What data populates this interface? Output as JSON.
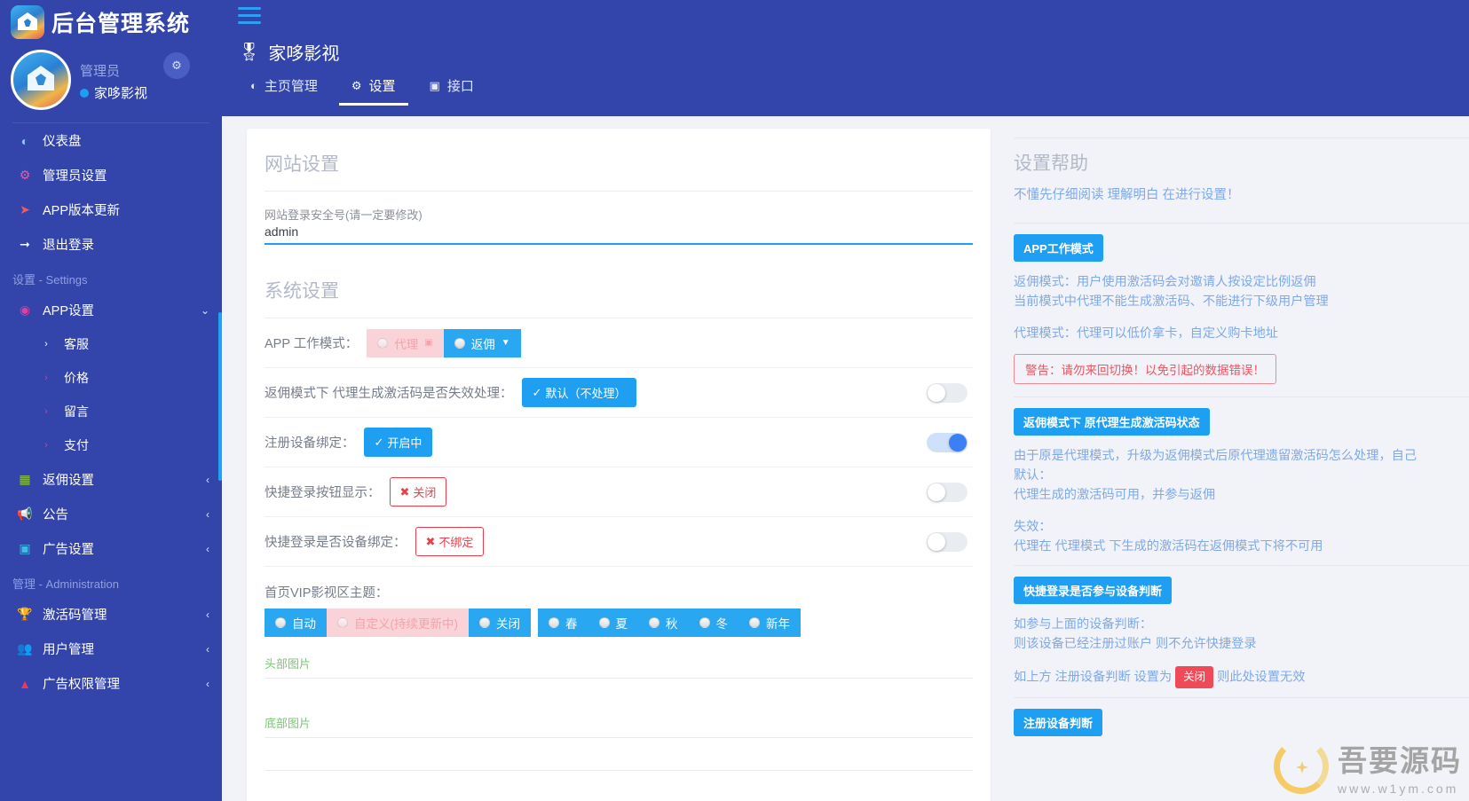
{
  "sidebar": {
    "brand_title": "后台管理系统",
    "gear_icon": "gear-icon",
    "profile": {
      "role": "管理员",
      "name": "家哆影视"
    },
    "top_items": [
      {
        "label": "仪表盘",
        "icon": "dashboard-icon"
      },
      {
        "label": "管理员设置",
        "icon": "gears-icon"
      },
      {
        "label": "APP版本更新",
        "icon": "paper-plane-icon"
      },
      {
        "label": "退出登录",
        "icon": "logout-icon"
      }
    ],
    "group_settings_title": "设置 - Settings",
    "settings_items": [
      {
        "label": "APP设置",
        "icon": "android-icon",
        "caret": "⌄",
        "expanded": true
      },
      {
        "label": "客服",
        "icon": "chevron-right-icon",
        "sub": true
      },
      {
        "label": "价格",
        "icon": "chevron-right-icon",
        "sub": true
      },
      {
        "label": "留言",
        "icon": "chevron-right-icon",
        "sub": true
      },
      {
        "label": "支付",
        "icon": "chevron-right-icon",
        "sub": true
      },
      {
        "label": "返佣设置",
        "icon": "card-icon",
        "caret": "‹"
      },
      {
        "label": "公告",
        "icon": "megaphone-icon",
        "caret": "‹"
      },
      {
        "label": "广告设置",
        "icon": "image-icon",
        "caret": "‹"
      }
    ],
    "group_admin_title": "管理 - Administration",
    "admin_items": [
      {
        "label": "激活码管理",
        "icon": "trophy-icon",
        "caret": "‹"
      },
      {
        "label": "用户管理",
        "icon": "users-icon",
        "caret": "‹"
      },
      {
        "label": "广告权限管理",
        "icon": "badge-icon",
        "caret": "‹"
      }
    ]
  },
  "topbar": {
    "hamburger": "hamburger-icon",
    "page_title": "家哆影视",
    "page_title_icon": "medal-icon",
    "tabs": [
      {
        "label": "主页管理",
        "icon": "home-manage-icon",
        "active": false
      },
      {
        "label": "设置",
        "icon": "gear-icon",
        "active": true
      },
      {
        "label": "接口",
        "icon": "api-icon",
        "active": false
      }
    ]
  },
  "form": {
    "section_site_title": "网站设置",
    "security_field_label": "网站登录安全号(请一定要修改)",
    "security_field_value": "admin",
    "section_system_title": "系统设置",
    "work_mode": {
      "label": "APP 工作模式：",
      "options": [
        {
          "label": "代理",
          "state": "disabled",
          "suffix_icon": "stamp-icon"
        },
        {
          "label": "返佣",
          "state": "active",
          "suffix_icon": "funnel-icon"
        }
      ]
    },
    "rows": [
      {
        "label": "返佣模式下 代理生成激活码是否失效处理：",
        "button": "默认（不处理）",
        "button_style": "blue",
        "button_icon": "check-circle-icon",
        "toggle": "off"
      },
      {
        "label": "注册设备绑定：",
        "button": "开启中",
        "button_style": "blue",
        "button_icon": "check-circle-icon",
        "toggle": "on"
      },
      {
        "label": "快捷登录按钮显示：",
        "button": "关闭",
        "button_style": "red-outline",
        "button_icon": "x-icon",
        "toggle": "off"
      },
      {
        "label": "快捷登录是否设备绑定：",
        "button": "不绑定",
        "button_style": "red-outline",
        "button_icon": "x-icon",
        "toggle": "off"
      }
    ],
    "theme": {
      "label": "首页VIP影视区主题：",
      "group_a": [
        {
          "label": "自动",
          "state": "active"
        },
        {
          "label": "自定义(持续更新中)",
          "state": "disabled"
        },
        {
          "label": "关闭",
          "state": "active"
        }
      ],
      "group_b": [
        {
          "label": "春",
          "state": "active"
        },
        {
          "label": "夏",
          "state": "active"
        },
        {
          "label": "秋",
          "state": "active"
        },
        {
          "label": "冬",
          "state": "active"
        },
        {
          "label": "新年",
          "state": "active"
        }
      ]
    },
    "header_image_label": "头部图片",
    "footer_image_label": "底部图片"
  },
  "help": {
    "title": "设置帮助",
    "subtitle": "不懂先仔细阅读 理解明白 在进行设置！",
    "block1": {
      "tag": "APP工作模式",
      "line1": "返佣模式：用户使用激活码会对邀请人按设定比例返佣",
      "line2": "当前模式中代理不能生成激活码、不能进行下级用户管理",
      "line3": "代理模式：代理可以低价拿卡，自定义购卡地址",
      "warning": "警告：请勿来回切换！以免引起的数据错误！"
    },
    "block2": {
      "tag": "返佣模式下 原代理生成激活码状态",
      "line1": "由于原是代理模式，升级为返佣模式后原代理遗留激活码怎么处理，自己",
      "line2": "默认：",
      "line3": "代理生成的激活码可用，并参与返佣",
      "line4": "失效：",
      "line5": "代理在 代理模式 下生成的激活码在返佣模式下将不可用"
    },
    "block3": {
      "tag": "快捷登录是否参与设备判断",
      "line1": "如参与上面的设备判断：",
      "line2": "则该设备已经注册过账户 则不允许快捷登录",
      "line3_pre": "如上方 注册设备判断 设置为",
      "line3_pill": "关闭",
      "line3_post": "则此处设置无效"
    },
    "block4": {
      "tag": "注册设备判断"
    }
  },
  "watermark": {
    "cn": "吾要源码",
    "en": "www.w1ym.com"
  },
  "colors": {
    "sidebar_bg": "#3344ab",
    "accent_blue": "#1e9ff2",
    "danger_red": "#e8404a",
    "help_text": "#7fa9e8"
  }
}
